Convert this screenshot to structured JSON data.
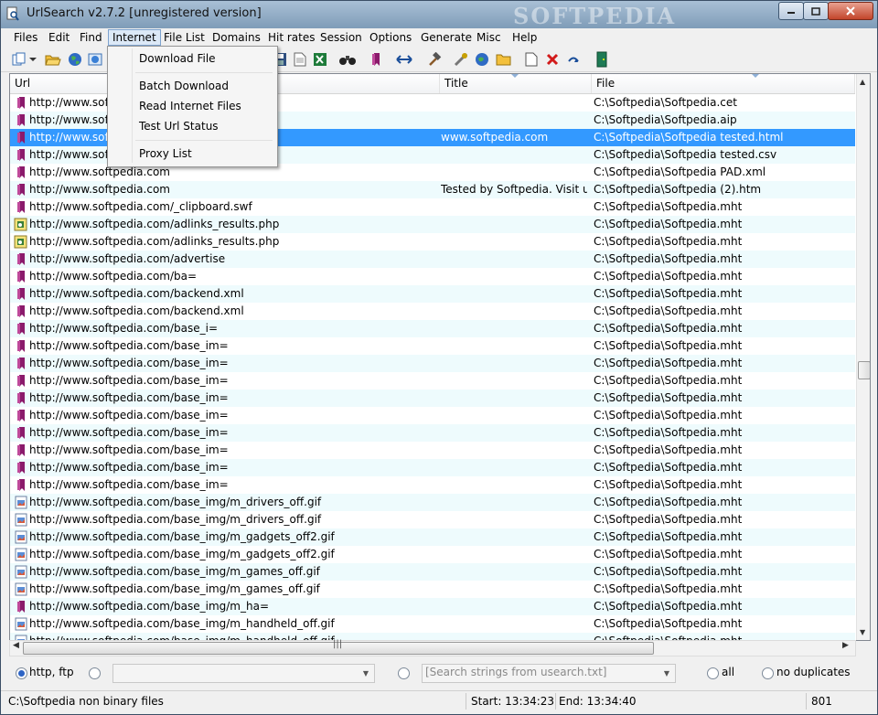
{
  "window": {
    "title": "UrlSearch v2.7.2 [unregistered version]",
    "watermark": "SOFTPEDIA"
  },
  "menubar": {
    "items": [
      "Files",
      "Edit",
      "Find",
      "Internet",
      "File List",
      "Domains",
      "Hit rates",
      "Session",
      "Options",
      "Generate",
      "Misc",
      "Help"
    ],
    "active": "Internet"
  },
  "toolbar": {
    "icons": [
      "copy-icon",
      "dropdown-arrow-icon",
      "open-folder-icon",
      "globe-icon",
      "web-icon",
      "save-icon",
      "excel-icon",
      "binoculars-icon",
      "bookmark-icon",
      "arrows-icon",
      "hammer-icon",
      "tools-icon",
      "globe-refresh-icon",
      "folder-icon",
      "new-page-icon",
      "delete-icon",
      "undo-icon",
      "exit-door-icon"
    ]
  },
  "internet_menu": {
    "items": [
      "Download File",
      "Batch Download",
      "Read Internet Files",
      "Test Url Status",
      "Proxy List"
    ]
  },
  "listview": {
    "columns": [
      "Url",
      "Title",
      "File"
    ],
    "rows": [
      {
        "icon": "bookmark",
        "url": "http://www.soft",
        "title": "",
        "file": "C:\\Softpedia\\Softpedia.cet"
      },
      {
        "icon": "bookmark",
        "url": "http://www.soft",
        "title": "",
        "file": "C:\\Softpedia\\Softpedia.aip"
      },
      {
        "icon": "bookmark",
        "url": "http://www.soft",
        "title": "www.softpedia.com",
        "file": "C:\\Softpedia\\Softpedia tested.html"
      },
      {
        "icon": "bookmark",
        "url": "http://www.soft",
        "title": "",
        "file": "C:\\Softpedia\\Softpedia tested.csv"
      },
      {
        "icon": "bookmark",
        "url": "http://www.softpedia.com",
        "title": "",
        "file": "C:\\Softpedia\\Softpedia PAD.xml"
      },
      {
        "icon": "bookmark",
        "url": "http://www.softpedia.com",
        "title": "Tested by Softpedia. Visit us ...",
        "file": "C:\\Softpedia\\Softpedia (2).htm"
      },
      {
        "icon": "bookmark",
        "url": "http://www.softpedia.com/_clipboard.swf",
        "title": "",
        "file": "C:\\Softpedia\\Softpedia.mht"
      },
      {
        "icon": "script",
        "url": "http://www.softpedia.com/adlinks_results.php",
        "title": "",
        "file": "C:\\Softpedia\\Softpedia.mht"
      },
      {
        "icon": "script",
        "url": "http://www.softpedia.com/adlinks_results.php",
        "title": "",
        "file": "C:\\Softpedia\\Softpedia.mht"
      },
      {
        "icon": "bookmark",
        "url": "http://www.softpedia.com/advertise",
        "title": "",
        "file": "C:\\Softpedia\\Softpedia.mht"
      },
      {
        "icon": "bookmark",
        "url": "http://www.softpedia.com/ba=",
        "title": "",
        "file": "C:\\Softpedia\\Softpedia.mht"
      },
      {
        "icon": "bookmark",
        "url": "http://www.softpedia.com/backend.xml",
        "title": "",
        "file": "C:\\Softpedia\\Softpedia.mht"
      },
      {
        "icon": "bookmark",
        "url": "http://www.softpedia.com/backend.xml",
        "title": "",
        "file": "C:\\Softpedia\\Softpedia.mht"
      },
      {
        "icon": "bookmark",
        "url": "http://www.softpedia.com/base_i=",
        "title": "",
        "file": "C:\\Softpedia\\Softpedia.mht"
      },
      {
        "icon": "bookmark",
        "url": "http://www.softpedia.com/base_im=",
        "title": "",
        "file": "C:\\Softpedia\\Softpedia.mht"
      },
      {
        "icon": "bookmark",
        "url": "http://www.softpedia.com/base_im=",
        "title": "",
        "file": "C:\\Softpedia\\Softpedia.mht"
      },
      {
        "icon": "bookmark",
        "url": "http://www.softpedia.com/base_im=",
        "title": "",
        "file": "C:\\Softpedia\\Softpedia.mht"
      },
      {
        "icon": "bookmark",
        "url": "http://www.softpedia.com/base_im=",
        "title": "",
        "file": "C:\\Softpedia\\Softpedia.mht"
      },
      {
        "icon": "bookmark",
        "url": "http://www.softpedia.com/base_im=",
        "title": "",
        "file": "C:\\Softpedia\\Softpedia.mht"
      },
      {
        "icon": "bookmark",
        "url": "http://www.softpedia.com/base_im=",
        "title": "",
        "file": "C:\\Softpedia\\Softpedia.mht"
      },
      {
        "icon": "bookmark",
        "url": "http://www.softpedia.com/base_im=",
        "title": "",
        "file": "C:\\Softpedia\\Softpedia.mht"
      },
      {
        "icon": "bookmark",
        "url": "http://www.softpedia.com/base_im=",
        "title": "",
        "file": "C:\\Softpedia\\Softpedia.mht"
      },
      {
        "icon": "bookmark",
        "url": "http://www.softpedia.com/base_im=",
        "title": "",
        "file": "C:\\Softpedia\\Softpedia.mht"
      },
      {
        "icon": "image",
        "url": "http://www.softpedia.com/base_img/m_drivers_off.gif",
        "title": "",
        "file": "C:\\Softpedia\\Softpedia.mht"
      },
      {
        "icon": "image",
        "url": "http://www.softpedia.com/base_img/m_drivers_off.gif",
        "title": "",
        "file": "C:\\Softpedia\\Softpedia.mht"
      },
      {
        "icon": "image",
        "url": "http://www.softpedia.com/base_img/m_gadgets_off2.gif",
        "title": "",
        "file": "C:\\Softpedia\\Softpedia.mht"
      },
      {
        "icon": "image",
        "url": "http://www.softpedia.com/base_img/m_gadgets_off2.gif",
        "title": "",
        "file": "C:\\Softpedia\\Softpedia.mht"
      },
      {
        "icon": "image",
        "url": "http://www.softpedia.com/base_img/m_games_off.gif",
        "title": "",
        "file": "C:\\Softpedia\\Softpedia.mht"
      },
      {
        "icon": "image",
        "url": "http://www.softpedia.com/base_img/m_games_off.gif",
        "title": "",
        "file": "C:\\Softpedia\\Softpedia.mht"
      },
      {
        "icon": "bookmark",
        "url": "http://www.softpedia.com/base_img/m_ha=",
        "title": "",
        "file": "C:\\Softpedia\\Softpedia.mht"
      },
      {
        "icon": "image",
        "url": "http://www.softpedia.com/base_img/m_handheld_off.gif",
        "title": "",
        "file": "C:\\Softpedia\\Softpedia.mht"
      },
      {
        "icon": "image",
        "url": "http://www.softpedia.com/base_img/m_handheld_off.gif",
        "title": "",
        "file": "C:\\Softpedia\\Softpedia.mht"
      }
    ],
    "selected_index": 2
  },
  "filterbar": {
    "protocol_label": "http, ftp",
    "search_placeholder": "[Search strings from usearch.txt]",
    "all_label": "all",
    "no_duplicates_label": "no duplicates"
  },
  "statusbar": {
    "path": "C:\\Softpedia non binary files",
    "start": "Start: 13:34:23",
    "end": "End: 13:34:40",
    "count": "801"
  },
  "colors": {
    "selection": "#3399ff",
    "alt_row": "#eefbfd",
    "bookmark_icon": "#8b1a6b"
  }
}
